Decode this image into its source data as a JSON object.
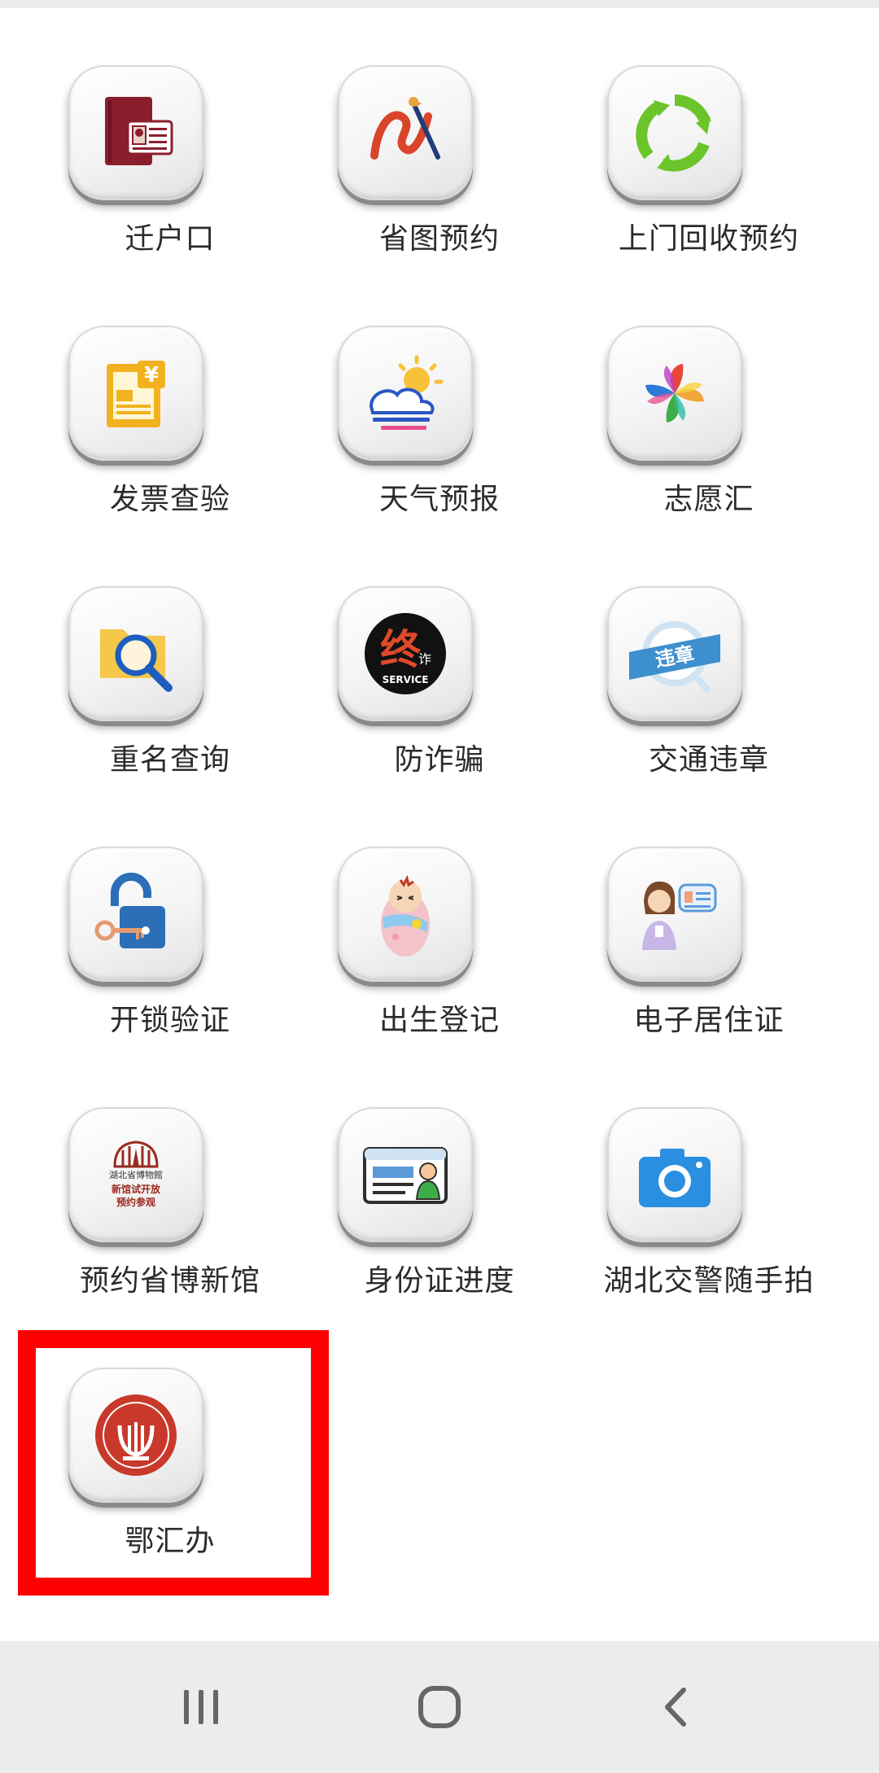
{
  "apps": [
    {
      "label": "迁户口",
      "icon": "passport-icon"
    },
    {
      "label": "省图预约",
      "icon": "paintbrush-icon"
    },
    {
      "label": "上门回收预约",
      "icon": "recycle-icon"
    },
    {
      "label": "发票查验",
      "icon": "invoice-icon"
    },
    {
      "label": "天气预报",
      "icon": "weather-icon"
    },
    {
      "label": "志愿汇",
      "icon": "pinwheel-icon"
    },
    {
      "label": "重名查询",
      "icon": "folder-search-icon"
    },
    {
      "label": "防诈骗",
      "icon": "anti-fraud-icon"
    },
    {
      "label": "交通违章",
      "icon": "traffic-violation-icon"
    },
    {
      "label": "开锁验证",
      "icon": "padlock-key-icon"
    },
    {
      "label": "出生登记",
      "icon": "baby-icon"
    },
    {
      "label": "电子居住证",
      "icon": "resident-card-icon"
    },
    {
      "label": "预约省博新馆",
      "icon": "museum-icon"
    },
    {
      "label": "身份证进度",
      "icon": "id-card-icon"
    },
    {
      "label": "湖北交警随手拍",
      "icon": "camera-icon"
    },
    {
      "label": "鄂汇办",
      "icon": "ehuiban-emblem-icon"
    }
  ],
  "icon_text": {
    "anti_fraud_char": "终",
    "anti_fraud_small": "诈",
    "anti_fraud_service": "SERVICE",
    "traffic_badge": "违章",
    "museum_name": "湖北省博物館",
    "museum_line1": "新馆试开放",
    "museum_line2": "预约参观"
  },
  "highlighted_app": "鄂汇办",
  "colors": {
    "highlight": "#ff0000",
    "navbar": "#ececec"
  },
  "navbar": [
    {
      "name": "recents-button",
      "icon": "recents-icon"
    },
    {
      "name": "home-button",
      "icon": "home-icon"
    },
    {
      "name": "back-button",
      "icon": "back-icon"
    }
  ]
}
